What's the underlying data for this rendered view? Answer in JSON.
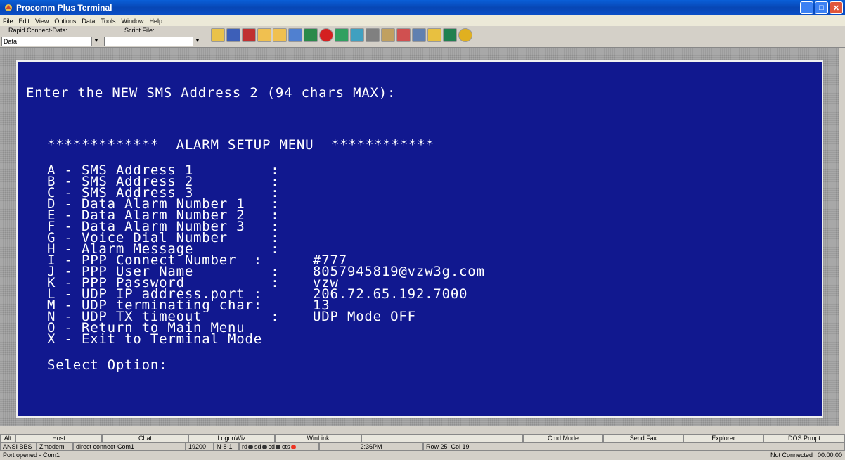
{
  "window": {
    "title": "Procomm Plus Terminal"
  },
  "menu": [
    "File",
    "Edit",
    "View",
    "Options",
    "Data",
    "Tools",
    "Window",
    "Help"
  ],
  "toolbar": {
    "rapid_connect_label": "Rapid Connect-Data:",
    "rapid_connect_value": "Data",
    "script_file_label": "Script File:",
    "script_file_value": ""
  },
  "terminal": {
    "prompt": "Enter the NEW SMS Address 2 (94 chars MAX):",
    "menu_title": "*************  ALARM SETUP MENU  ************",
    "items": [
      {
        "label": "A - SMS Address 1         :",
        "value": ""
      },
      {
        "label": "B - SMS Address 2         :",
        "value": ""
      },
      {
        "label": "C - SMS Address 3         :",
        "value": ""
      },
      {
        "label": "D - Data Alarm Number 1   :",
        "value": ""
      },
      {
        "label": "E - Data Alarm Number 2   :",
        "value": ""
      },
      {
        "label": "F - Data Alarm Number 3   :",
        "value": ""
      },
      {
        "label": "G - Voice Dial Number     :",
        "value": ""
      },
      {
        "label": "H - Alarm Message         :",
        "value": ""
      },
      {
        "label": "I - PPP Connect Number  :",
        "value": "#777"
      },
      {
        "label": "J - PPP User Name         :",
        "value": "8057945819@vzw3g.com"
      },
      {
        "label": "K - PPP Password          :",
        "value": "vzw"
      },
      {
        "label": "L - UDP IP address.port :",
        "value": "206.72.65.192.7000"
      },
      {
        "label": "M - UDP terminating char:",
        "value": "13"
      },
      {
        "label": "N - UDP TX timeout        :",
        "value": "UDP Mode OFF"
      },
      {
        "label": "O - Return to Main Menu",
        "value": ""
      },
      {
        "label": "X - Exit to Terminal Mode",
        "value": ""
      }
    ],
    "select": "Select Option:"
  },
  "buttons": [
    "Alt",
    "Host",
    "Chat",
    "LogonWiz",
    "WinLink",
    "",
    "Cmd Mode",
    "Send Fax",
    "Explorer",
    "DOS Prmpt"
  ],
  "status": {
    "emulation": "ANSI BBS",
    "protocol": "Zmodem",
    "connection": "direct connect-Com1",
    "baud": "19200",
    "settings": "N-8-1",
    "leds": [
      "rd",
      "sd",
      "cd",
      "cts"
    ],
    "time": "2:36PM",
    "row": "Row 25",
    "col": "Col 19"
  },
  "bottom": {
    "port": "Port opened - Com1",
    "connected": "Not Connected",
    "elapsed": "00:00:00"
  },
  "colors": {
    "terminal_bg": "#11188f",
    "title_bar": "#0746b4"
  }
}
